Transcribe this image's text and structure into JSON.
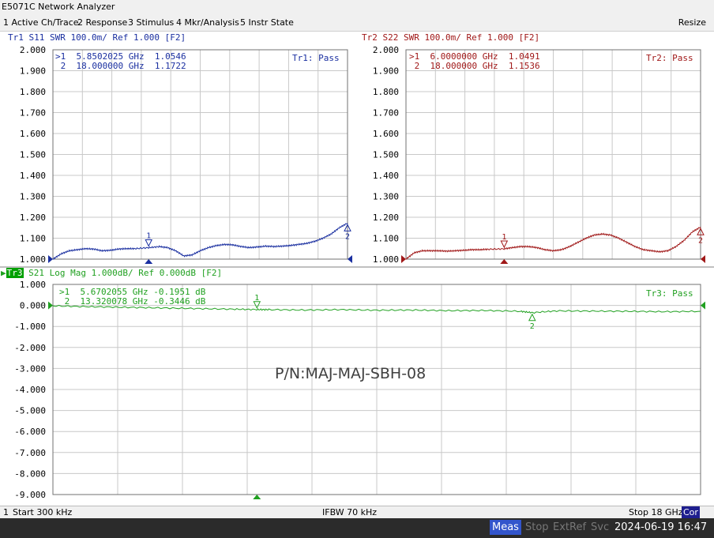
{
  "window": {
    "title": "E5071C Network Analyzer"
  },
  "menu": {
    "items": [
      "1 Active Ch/Trace",
      "2 Response",
      "3 Stimulus",
      "4 Mkr/Analysis",
      "5 Instr State"
    ],
    "resize": "Resize"
  },
  "trace1": {
    "header": "Tr1 S11 SWR 100.0m/ Ref 1.000 [F2]",
    "status": "Tr1: Pass",
    "markers": [
      ">1  5.8502025 GHz  1.0546",
      " 2  18.000000 GHz  1.1722"
    ],
    "y_labels": [
      "2.000",
      "1.900",
      "1.800",
      "1.700",
      "1.600",
      "1.500",
      "1.400",
      "1.300",
      "1.200",
      "1.100",
      "1.000"
    ],
    "color": "#1a2fa0"
  },
  "trace2": {
    "header": "Tr2 S22 SWR 100.0m/ Ref 1.000 [F2]",
    "status": "Tr2: Pass",
    "markers": [
      ">1  6.0000000 GHz  1.0491",
      " 2  18.000000 GHz  1.1536"
    ],
    "color": "#a01818"
  },
  "trace3": {
    "tag": "Tr3",
    "header": "S21 Log Mag 1.000dB/ Ref 0.000dB [F2]",
    "status": "Tr3: Pass",
    "markers": [
      ">1  5.6702055 GHz -0.1951 dB",
      " 2  13.320078 GHz -0.3446 dB"
    ],
    "y_labels": [
      "1.000",
      "0.000",
      "-1.000",
      "-2.000",
      "-3.000",
      "-4.000",
      "-5.000",
      "-6.000",
      "-7.000",
      "-8.000",
      "-9.000"
    ],
    "color": "#20a020"
  },
  "marker_labels": {
    "m1": "1",
    "m2": "2"
  },
  "annotation": "P/N:MAJ-MAJ-SBH-08",
  "status_bar": {
    "channel": "1",
    "start": "Start 300 kHz",
    "ifbw": "IFBW 70 kHz",
    "stop": "Stop 18 GHz",
    "cor": "Cor"
  },
  "bottom_bar": {
    "meas": "Meas",
    "stop": "Stop",
    "extref": "ExtRef",
    "svc": "Svc",
    "datetime": "2024-06-19 16:47"
  },
  "chart_data": [
    {
      "type": "line",
      "title": "Tr1 S11 SWR 100.0m/ Ref 1.000 [F2]",
      "xlabel": "",
      "ylabel": "",
      "x_range_ghz": [
        0.0003,
        18
      ],
      "ylim": [
        1.0,
        2.0
      ],
      "grid": true,
      "series": [
        {
          "name": "S11",
          "x": [
            0.0003,
            0.5,
            1,
            1.5,
            2,
            2.5,
            3,
            3.5,
            4,
            4.5,
            5,
            5.85,
            6.5,
            7,
            7.5,
            8,
            8.5,
            9,
            9.5,
            10,
            10.5,
            11,
            11.5,
            12,
            12.5,
            13,
            13.5,
            14,
            14.5,
            15,
            15.5,
            16,
            16.5,
            17,
            17.5,
            18
          ],
          "y": [
            1.0,
            1.025,
            1.04,
            1.045,
            1.05,
            1.048,
            1.04,
            1.042,
            1.048,
            1.05,
            1.05,
            1.0546,
            1.06,
            1.055,
            1.04,
            1.015,
            1.02,
            1.04,
            1.055,
            1.065,
            1.07,
            1.068,
            1.06,
            1.055,
            1.058,
            1.062,
            1.06,
            1.062,
            1.065,
            1.07,
            1.075,
            1.085,
            1.1,
            1.12,
            1.15,
            1.1722
          ]
        }
      ],
      "markers": [
        {
          "x": 5.8502025,
          "y": 1.0546
        },
        {
          "x": 18.0,
          "y": 1.1722
        }
      ]
    },
    {
      "type": "line",
      "title": "Tr2 S22 SWR 100.0m/ Ref 1.000 [F2]",
      "xlabel": "",
      "ylabel": "",
      "x_range_ghz": [
        0.0003,
        18
      ],
      "ylim": [
        1.0,
        2.0
      ],
      "grid": true,
      "series": [
        {
          "name": "S22",
          "x": [
            0.0003,
            0.5,
            1,
            1.5,
            2,
            2.5,
            3,
            3.5,
            4,
            4.5,
            5,
            6,
            6.5,
            7,
            7.5,
            8,
            8.5,
            9,
            9.5,
            10,
            10.5,
            11,
            11.5,
            12,
            12.5,
            13,
            13.5,
            14,
            14.5,
            15,
            15.5,
            16,
            16.5,
            17,
            17.5,
            18
          ],
          "y": [
            1.0,
            1.03,
            1.04,
            1.04,
            1.04,
            1.038,
            1.04,
            1.042,
            1.045,
            1.045,
            1.047,
            1.0491,
            1.055,
            1.06,
            1.06,
            1.055,
            1.045,
            1.04,
            1.045,
            1.06,
            1.08,
            1.1,
            1.115,
            1.12,
            1.115,
            1.1,
            1.08,
            1.06,
            1.045,
            1.04,
            1.035,
            1.04,
            1.06,
            1.09,
            1.13,
            1.1536
          ]
        }
      ],
      "markers": [
        {
          "x": 6.0,
          "y": 1.0491
        },
        {
          "x": 18.0,
          "y": 1.1536
        }
      ]
    },
    {
      "type": "line",
      "title": "S21 Log Mag 1.000dB/ Ref 0.000dB [F2]",
      "xlabel": "",
      "ylabel": "",
      "x_range_ghz": [
        0.0003,
        18
      ],
      "ylim": [
        -9.0,
        1.0
      ],
      "grid": true,
      "series": [
        {
          "name": "S21",
          "x": [
            0.0003,
            1,
            2,
            3,
            4,
            5,
            5.67,
            6,
            7,
            8,
            9,
            10,
            11,
            12,
            13,
            13.32,
            14,
            15,
            16,
            17,
            18
          ],
          "y": [
            -0.02,
            -0.06,
            -0.09,
            -0.12,
            -0.15,
            -0.18,
            -0.1951,
            -0.2,
            -0.22,
            -0.2,
            -0.23,
            -0.22,
            -0.25,
            -0.24,
            -0.28,
            -0.3446,
            -0.26,
            -0.27,
            -0.28,
            -0.3,
            -0.28
          ]
        }
      ],
      "markers": [
        {
          "x": 5.6702055,
          "y": -0.1951
        },
        {
          "x": 13.320078,
          "y": -0.3446
        }
      ]
    }
  ]
}
